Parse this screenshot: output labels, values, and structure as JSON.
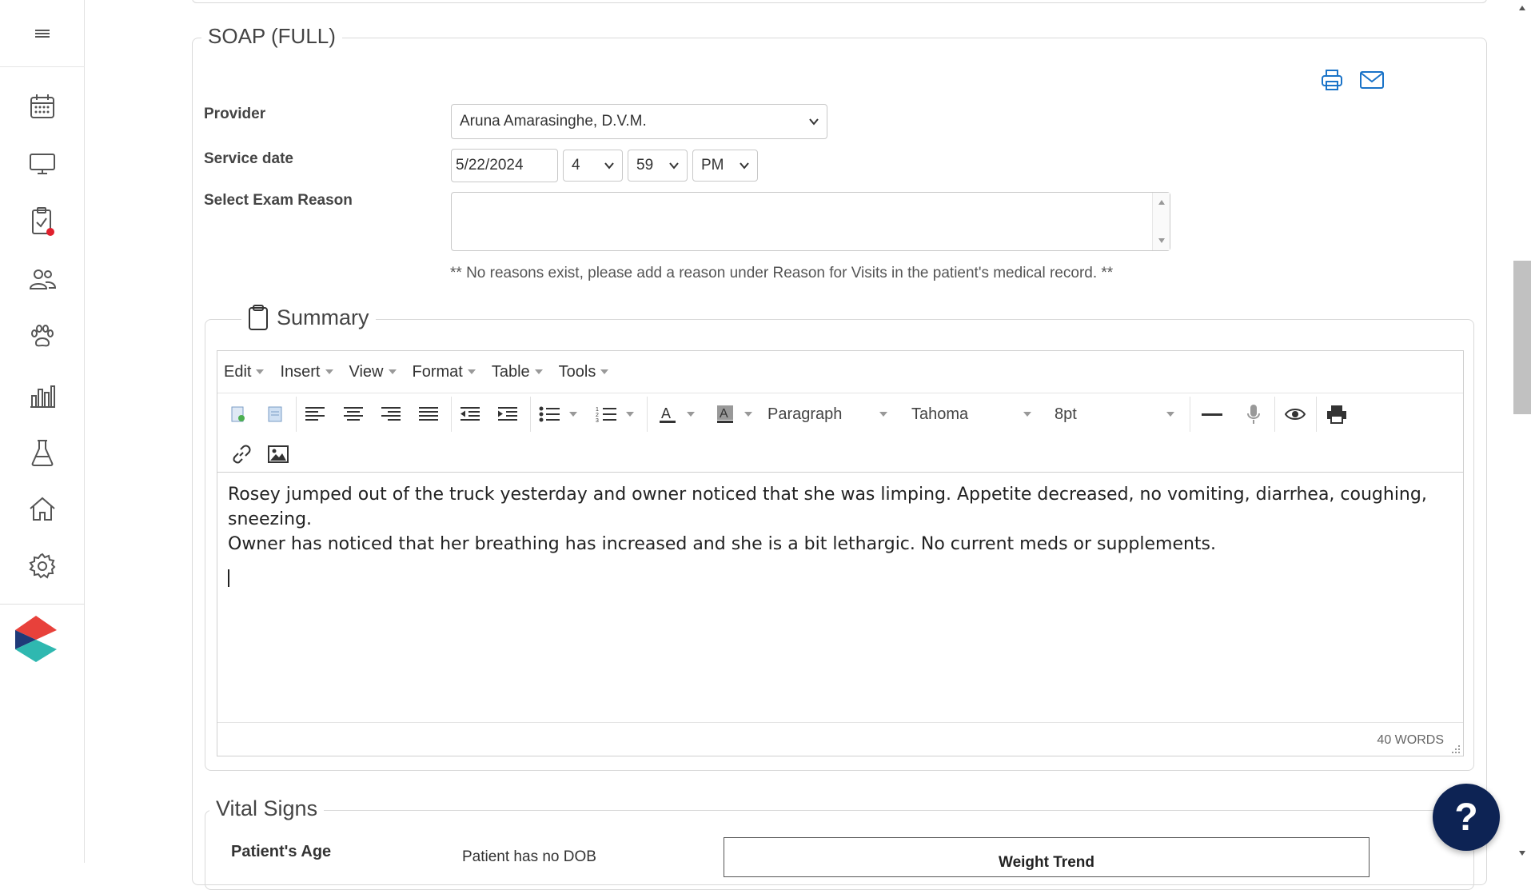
{
  "sidebar": {
    "items": [
      {
        "icon": "calendar-icon"
      },
      {
        "icon": "monitor-icon"
      },
      {
        "icon": "clipboard-alert-icon",
        "badge_color": "#e0202d"
      },
      {
        "icon": "users-icon"
      },
      {
        "icon": "paw-icon"
      },
      {
        "icon": "bar-chart-icon"
      },
      {
        "icon": "flask-icon"
      },
      {
        "icon": "home-icon"
      },
      {
        "icon": "settings-icon"
      }
    ],
    "logo_colors": [
      "#e8413b",
      "#1f3a78",
      "#2fb8b0"
    ]
  },
  "soap": {
    "legend": "SOAP (FULL)",
    "provider_label": "Provider",
    "provider_value": "Aruna Amarasinghe, D.V.M.",
    "service_date_label": "Service date",
    "service_date": "5/22/2024",
    "hour": "4",
    "minute": "59",
    "ampm": "PM",
    "exam_reason_label": "Select Exam Reason",
    "no_reasons_note": "** No reasons exist, please add a reason under Reason for Visits in the patient's medical record. **"
  },
  "summary": {
    "legend": "Summary",
    "menus": [
      "Edit",
      "Insert",
      "View",
      "Format",
      "Table",
      "Tools"
    ],
    "block_format": "Paragraph",
    "font_family": "Tahoma",
    "font_size": "8pt",
    "content_lines": [
      "Rosey jumped out of the truck yesterday and owner noticed that she was limping. Appetite decreased, no vomiting, diarrhea, coughing, sneezing.",
      "Owner has noticed that her breathing has increased and she is a bit lethargic. No current meds or supplements."
    ],
    "word_count": "40 WORDS"
  },
  "vitals": {
    "legend": "Vital Signs",
    "age_label": "Patient's Age",
    "age_value": "Patient has no DOB",
    "weight_trend_title": "Weight Trend"
  },
  "help": {
    "label": "?"
  },
  "colors": {
    "accent": "#1a73c8",
    "help_bg": "#0d2354"
  }
}
